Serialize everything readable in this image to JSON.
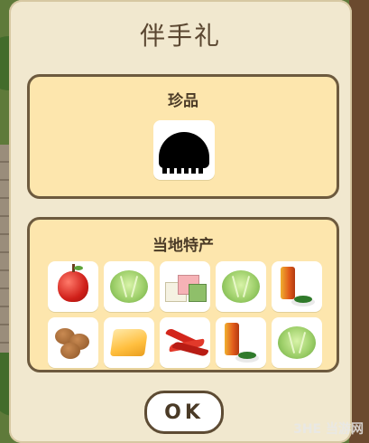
{
  "dialog": {
    "title": "伴手礼"
  },
  "rare_section": {
    "title": "珍品",
    "items": [
      {
        "icon": "black-silhouette-icon"
      }
    ]
  },
  "local_section": {
    "title": "当地特产",
    "items": [
      {
        "icon": "apple-icon"
      },
      {
        "icon": "cabbage-icon"
      },
      {
        "icon": "tricolor-mochi-icon"
      },
      {
        "icon": "cabbage-icon"
      },
      {
        "icon": "canned-food-with-vegetables-icon"
      },
      {
        "icon": "manju-buns-icon"
      },
      {
        "icon": "cheese-icon"
      },
      {
        "icon": "red-chili-peppers-icon"
      },
      {
        "icon": "canned-food-with-vegetables-icon"
      },
      {
        "icon": "cabbage-icon"
      }
    ]
  },
  "ok_button": {
    "label": "OK"
  },
  "watermark": {
    "text": "3HE 当游网"
  },
  "colors": {
    "dialog_bg": "#f1e8cf",
    "panel_bg": "#fde6ad",
    "panel_border": "#6d5a3e",
    "text": "#4a3a26"
  }
}
